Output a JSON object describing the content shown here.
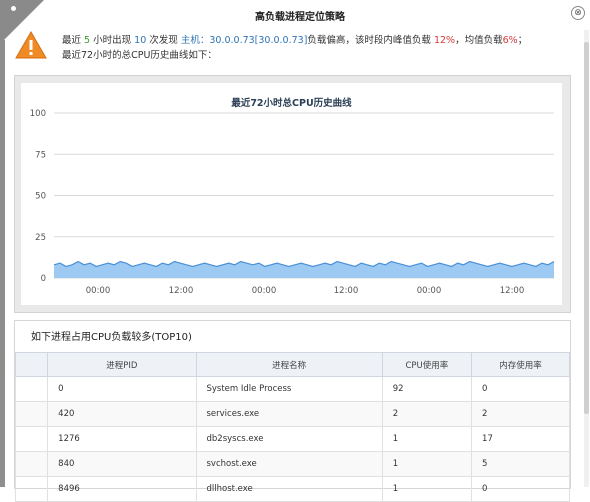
{
  "dialog": {
    "title": "高负载进程定位策略",
    "close_icon": "⊗"
  },
  "message": {
    "part1": "最近",
    "hours": "5",
    "part2": "小时出现",
    "count": "10",
    "part3": "次发现",
    "host_label": "主机：",
    "host_value": "30.0.0.73[30.0.0.73]",
    "part4": "负载偏高，该时段内峰值负载",
    "peak": "12%",
    "part5": "，均值负载",
    "avg": "6%",
    "part6": "；",
    "line2": "最近72小时的总CPU历史曲线如下："
  },
  "colors": {
    "line": "#4a90d8",
    "area": "#9ccaf2",
    "grid": "#d9d9d9"
  },
  "chart_data": {
    "type": "area",
    "title": "最近72小时总CPU历史曲线",
    "yticks": [
      "100",
      "75",
      "50",
      "25",
      "0"
    ],
    "xticks": [
      "00:00",
      "12:00",
      "00:00",
      "12:00",
      "00:00",
      "12:00"
    ],
    "ylim": [
      0,
      100
    ],
    "grid": true,
    "values": [
      8,
      9,
      7,
      8,
      10,
      8,
      9,
      7,
      8,
      9,
      8,
      10,
      9,
      7,
      8,
      9,
      8,
      7,
      9,
      8,
      10,
      9,
      8,
      7,
      8,
      9,
      8,
      7,
      8,
      9,
      8,
      10,
      9,
      8,
      9,
      7,
      8,
      9,
      8,
      7,
      8,
      9,
      8,
      7,
      8,
      9,
      8,
      10,
      9,
      8,
      7,
      9,
      8,
      7,
      9,
      8,
      10,
      9,
      8,
      7,
      8,
      9,
      7,
      8,
      9,
      8,
      7,
      9,
      8,
      10,
      9,
      8,
      7,
      8,
      9,
      8,
      7,
      8,
      9,
      8,
      7,
      9,
      8,
      10
    ]
  },
  "table": {
    "title": "如下进程占用CPU负载较多(TOP10)",
    "headers": [
      "进程PID",
      "进程名称",
      "CPU使用率",
      "内存使用率"
    ],
    "rows": [
      [
        "0",
        "System Idle Process",
        "92",
        "0"
      ],
      [
        "420",
        "services.exe",
        "2",
        "2"
      ],
      [
        "1276",
        "db2syscs.exe",
        "1",
        "17"
      ],
      [
        "840",
        "svchost.exe",
        "1",
        "5"
      ],
      [
        "8496",
        "dllhost.exe",
        "1",
        "0"
      ]
    ]
  }
}
